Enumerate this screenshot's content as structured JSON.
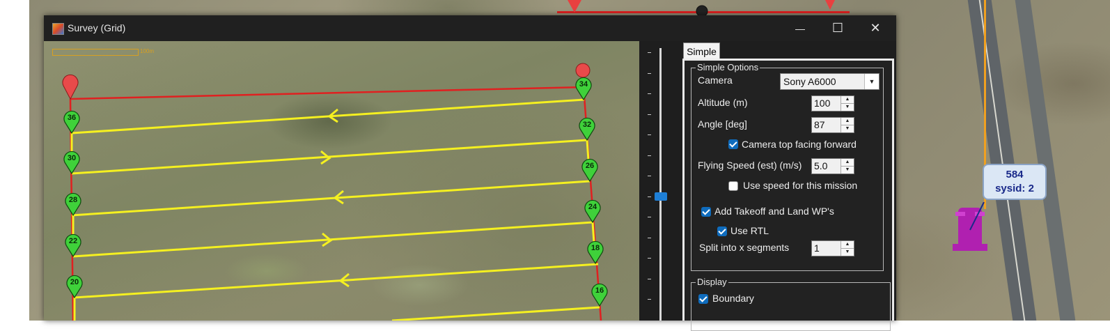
{
  "window": {
    "title": "Survey (Grid)",
    "minimize_glyph": "—",
    "maximize_glyph": "☐",
    "close_glyph": "✕"
  },
  "map": {
    "scale_label": "100m",
    "waypoints_left": [
      "36",
      "30",
      "28",
      "22",
      "20"
    ],
    "waypoints_right": [
      "34",
      "32",
      "26",
      "24",
      "18",
      "16"
    ]
  },
  "background_map": {
    "vehicle_label_line1": "584",
    "vehicle_label_line2": "sysid: 2",
    "vehicle_color": "#b020b0",
    "route_color": "#e02020",
    "grid_color": "#f5f020"
  },
  "tabs": [
    "Simple"
  ],
  "simple_options": {
    "group_label": "Simple Options",
    "camera_label": "Camera",
    "camera_value": "Sony A6000",
    "altitude_label": "Altitude (m)",
    "altitude_value": "100",
    "angle_label": "Angle [deg]",
    "angle_value": "87",
    "camera_top_label": "Camera top facing forward",
    "camera_top_checked": true,
    "flying_speed_label": "Flying Speed (est) (m/s)",
    "flying_speed_value": "5.0",
    "use_speed_label": "Use speed for this mission",
    "use_speed_checked": false,
    "takeoff_land_label": "Add Takeoff and Land WP's",
    "takeoff_land_checked": true,
    "use_rtl_label": "Use RTL",
    "use_rtl_checked": true,
    "split_label": "Split into x segments",
    "split_value": "1"
  },
  "display": {
    "group_label": "Display",
    "boundary_label": "Boundary",
    "boundary_checked": true
  }
}
